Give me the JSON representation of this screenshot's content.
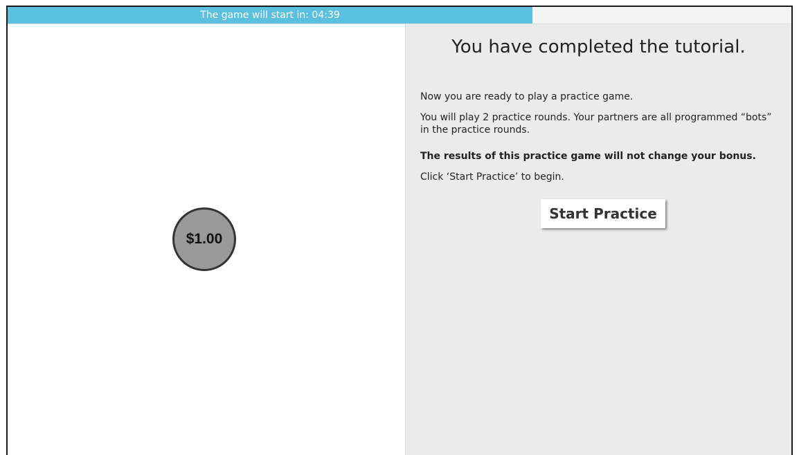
{
  "timer": {
    "label": "The game will start in: 04:39",
    "progress_fraction": 0.67,
    "fill_color": "#5bc0de"
  },
  "game": {
    "coin_value": "$1.00"
  },
  "tutorial": {
    "title": "You have completed the tutorial.",
    "line1": "Now you are ready to play a practice game.",
    "line2": "You will play 2 practice rounds. Your partners are all programmed “bots” in the practice rounds.",
    "line3": "The results of this practice game will not change your bonus.",
    "line4": "Click ‘Start Practice’ to begin.",
    "start_button_label": "Start Practice"
  },
  "colors": {
    "right_panel_bg": "#ebebeb",
    "coin_fill": "#999999"
  }
}
